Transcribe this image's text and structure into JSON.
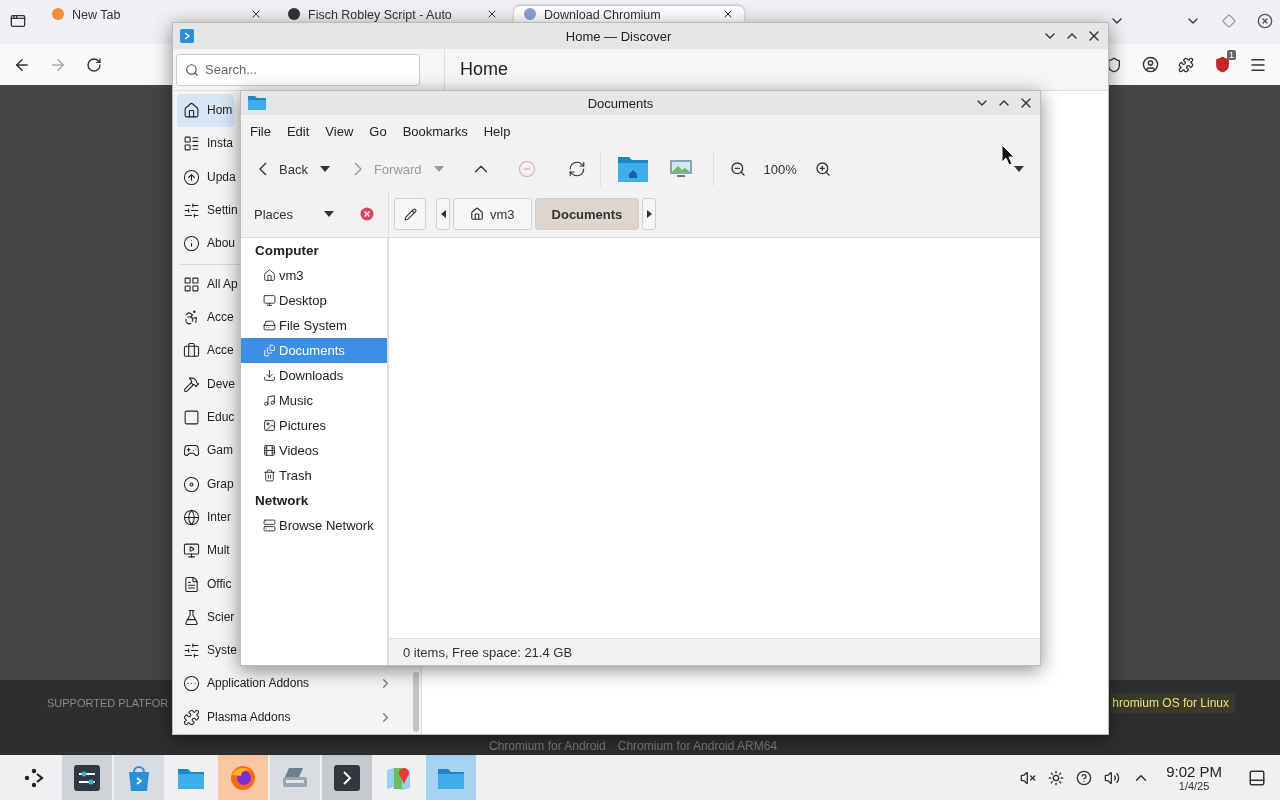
{
  "browser": {
    "tabs": [
      {
        "title": "New Tab",
        "selected": false
      },
      {
        "title": "Fisch Robley Script - Auto",
        "selected": false
      },
      {
        "title": "Download Chromium",
        "selected": true
      }
    ],
    "extension_badge": "1",
    "page": {
      "footer_label": "SUPPORTED PLATFOR",
      "highlight": "hromium OS for Linux",
      "links": [
        "Chromium for Android",
        "Chromium for Android ARM64"
      ]
    }
  },
  "discover": {
    "title": "Home — Discover",
    "search": {
      "placeholder": "Search..."
    },
    "heading": "Home",
    "sidebar_groups": [
      [
        {
          "label": "Hom",
          "selected": true,
          "submenu": false
        },
        {
          "label": "Insta",
          "selected": false,
          "submenu": false
        },
        {
          "label": "Upda",
          "selected": false,
          "submenu": false
        },
        {
          "label": "Settin",
          "selected": false,
          "submenu": false
        },
        {
          "label": "Abou",
          "selected": false,
          "submenu": false
        }
      ],
      [
        {
          "label": "All Ap",
          "selected": false,
          "submenu": false
        },
        {
          "label": "Acce",
          "selected": false,
          "submenu": false
        },
        {
          "label": "Acce",
          "selected": false,
          "submenu": false
        },
        {
          "label": "Deve",
          "selected": false,
          "submenu": false
        },
        {
          "label": "Educ",
          "selected": false,
          "submenu": false
        },
        {
          "label": "Gam",
          "selected": false,
          "submenu": false
        },
        {
          "label": "Grap",
          "selected": false,
          "submenu": false
        },
        {
          "label": "Inter",
          "selected": false,
          "submenu": false
        },
        {
          "label": "Mult",
          "selected": false,
          "submenu": false
        },
        {
          "label": "Offic",
          "selected": false,
          "submenu": false
        },
        {
          "label": "Scier",
          "selected": false,
          "submenu": false
        },
        {
          "label": "Syste",
          "selected": false,
          "submenu": false
        },
        {
          "label": "Application Addons",
          "selected": false,
          "submenu": true
        },
        {
          "label": "Plasma Addons",
          "selected": false,
          "submenu": true
        }
      ]
    ]
  },
  "documents": {
    "title": "Documents",
    "menu": [
      "File",
      "Edit",
      "View",
      "Go",
      "Bookmarks",
      "Help"
    ],
    "toolbar": {
      "back": {
        "label": "Back",
        "disabled": false
      },
      "forward": {
        "label": "Forward",
        "disabled": true
      },
      "zoom": "100%"
    },
    "places_label": "Places",
    "path": [
      {
        "label": "vm3",
        "selected": false
      },
      {
        "label": "Documents",
        "selected": true
      }
    ],
    "places": [
      {
        "heading": "Computer",
        "items": [
          {
            "label": "vm3",
            "selected": false
          },
          {
            "label": "Desktop",
            "selected": false
          },
          {
            "label": "File System",
            "selected": false
          },
          {
            "label": "Documents",
            "selected": true
          },
          {
            "label": "Downloads",
            "selected": false
          },
          {
            "label": "Music",
            "selected": false
          },
          {
            "label": "Pictures",
            "selected": false
          },
          {
            "label": "Videos",
            "selected": false
          },
          {
            "label": "Trash",
            "selected": false
          }
        ]
      },
      {
        "heading": "Network",
        "items": [
          {
            "label": "Browse Network",
            "selected": false
          }
        ]
      }
    ],
    "status": "0 items, Free space: 21.4 GB"
  },
  "taskbar": {
    "apps": [
      {
        "open": true
      },
      {
        "open": true
      },
      {
        "open": false
      },
      {
        "open": true
      },
      {
        "open": true
      },
      {
        "open": true
      },
      {
        "open": false
      },
      {
        "open": true
      }
    ],
    "time": "9:02 PM",
    "date": "1/4/25"
  }
}
